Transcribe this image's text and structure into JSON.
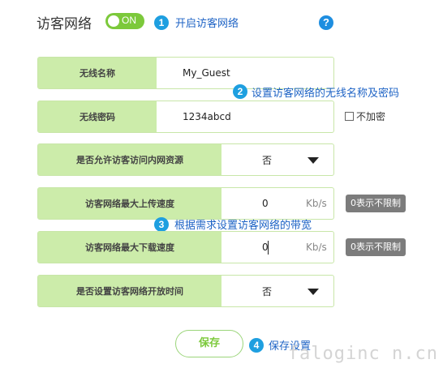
{
  "page_title": "访客网络",
  "toggle": {
    "label": "ON",
    "state": "on"
  },
  "help_icon_text": "?",
  "steps": [
    {
      "num": "1",
      "text": "开启访客网络"
    },
    {
      "num": "2",
      "text": "设置访客网络的无线名称及密码"
    },
    {
      "num": "3",
      "text": "根据需求设置访客网络的带宽"
    },
    {
      "num": "4",
      "text": "保存设置"
    }
  ],
  "fields": {
    "ssid": {
      "label": "无线名称",
      "value": "My_Guest"
    },
    "password": {
      "label": "无线密码",
      "value": "1234abcd",
      "no_encrypt_label": "不加密"
    },
    "allow_lan": {
      "label": "是否允许访客访问内网资源",
      "value": "否"
    },
    "upload": {
      "label": "访客网络最大上传速度",
      "value": "0",
      "unit": "Kb/s",
      "hint": "0表示不限制"
    },
    "download": {
      "label": "访客网络最大下载速度",
      "value": "0",
      "unit": "Kb/s",
      "hint": "0表示不限制"
    },
    "open_time": {
      "label": "是否设置访客网络开放时间",
      "value": "否"
    }
  },
  "save_label": "保存",
  "watermark": "faloginc n.cn",
  "colors": {
    "accent_green": "#7cc93b",
    "label_bg": "#ccecaa",
    "step_blue": "#1e9fe0",
    "note_blue": "#1e63c5"
  }
}
